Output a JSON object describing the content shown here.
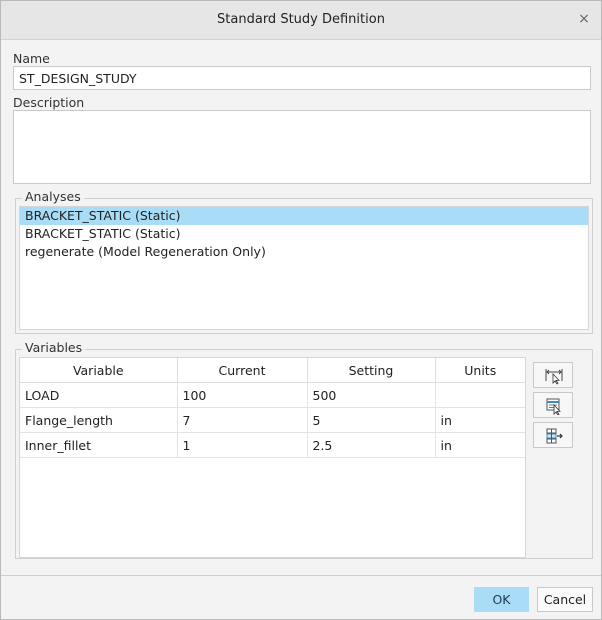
{
  "dialog": {
    "title": "Standard Study Definition",
    "close_label": "×"
  },
  "name": {
    "label": "Name",
    "value": "ST_DESIGN_STUDY"
  },
  "description": {
    "label": "Description",
    "value": ""
  },
  "analyses": {
    "label": "Analyses",
    "items": [
      {
        "label": "BRACKET_STATIC (Static)",
        "selected": true
      },
      {
        "label": "BRACKET_STATIC (Static)",
        "selected": false
      },
      {
        "label": "regenerate (Model Regeneration Only)",
        "selected": false
      }
    ]
  },
  "variables": {
    "label": "Variables",
    "columns": [
      "Variable",
      "Current",
      "Setting",
      "Units"
    ],
    "rows": [
      [
        "LOAD",
        "100",
        "500",
        ""
      ],
      [
        "Flange_length",
        "7",
        "5",
        "in"
      ],
      [
        "Inner_fillet",
        "1",
        "2.5",
        "in"
      ]
    ]
  },
  "side_buttons": [
    "select-dimension-icon",
    "select-parameter-icon",
    "add-variable-icon"
  ],
  "footer": {
    "ok_label": "OK",
    "cancel_label": "Cancel"
  },
  "colors": {
    "selection": "#a9dcf7",
    "dialog_bg": "#f3f3f3",
    "title_bg": "#e6e6e6"
  }
}
